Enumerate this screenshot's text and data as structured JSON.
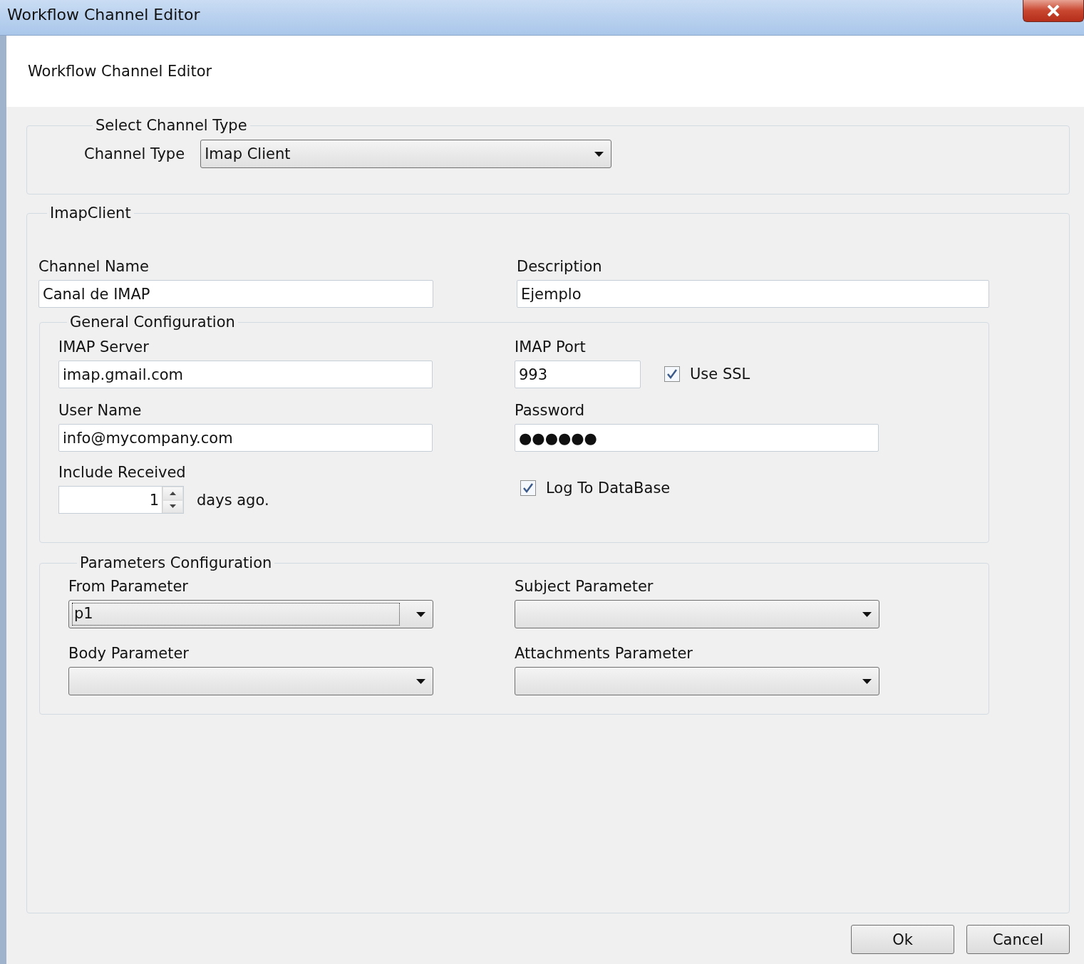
{
  "window": {
    "title": "Workflow Channel Editor"
  },
  "header": {
    "title": "Workflow Channel Editor"
  },
  "channel_type_group": {
    "legend": "Select Channel Type",
    "label": "Channel Type",
    "value": "Imap Client"
  },
  "imap_group": {
    "legend": "ImapClient",
    "channel_name": {
      "label": "Channel Name",
      "value": "Canal de IMAP"
    },
    "description": {
      "label": "Description",
      "value": "Ejemplo"
    },
    "general": {
      "legend": "General Configuration",
      "imap_server": {
        "label": "IMAP Server",
        "value": "imap.gmail.com"
      },
      "imap_port": {
        "label": "IMAP Port",
        "value": "993"
      },
      "use_ssl": {
        "label": "Use SSL",
        "checked": true
      },
      "user_name": {
        "label": "User Name",
        "value": "info@mycompany.com"
      },
      "password": {
        "label": "Password",
        "value": "●●●●●●"
      },
      "include_received": {
        "label": "Include Received",
        "value": "1",
        "suffix": "days ago."
      },
      "log_to_db": {
        "label": "Log To DataBase",
        "checked": true
      }
    },
    "parameters": {
      "legend": "Parameters Configuration",
      "fields": [
        {
          "label": "From Parameter",
          "value": "p1",
          "focused": true
        },
        {
          "label": "Subject Parameter",
          "focused": false
        },
        {
          "label": "Body Parameter",
          "focused": false
        },
        {
          "label": "Attachments Parameter",
          "focused": false
        }
      ]
    }
  },
  "buttons": [
    {
      "label": "Ok"
    },
    {
      "label": "Cancel"
    }
  ]
}
